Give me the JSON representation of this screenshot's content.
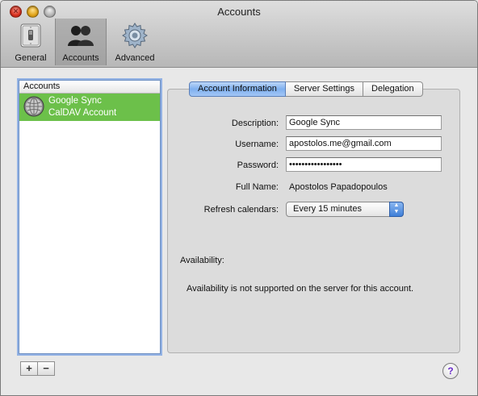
{
  "window": {
    "title": "Accounts"
  },
  "toolbar": {
    "items": [
      {
        "label": "General"
      },
      {
        "label": "Accounts"
      },
      {
        "label": "Advanced"
      }
    ]
  },
  "sidebar": {
    "header": "Accounts",
    "accounts": [
      {
        "name": "Google Sync",
        "type": "CalDAV Account",
        "selected_color": "#6cc04a"
      }
    ],
    "add_label": "+",
    "remove_label": "−"
  },
  "tabs": [
    {
      "label": "Account Information",
      "active": true
    },
    {
      "label": "Server Settings",
      "active": false
    },
    {
      "label": "Delegation",
      "active": false
    }
  ],
  "form": {
    "description_label": "Description:",
    "description_value": "Google Sync",
    "username_label": "Username:",
    "username_value": "apostolos.me@gmail.com",
    "password_label": "Password:",
    "password_value": "•••••••••••••••••",
    "fullname_label": "Full Name:",
    "fullname_value": "Apostolos Papadopoulos",
    "refresh_label": "Refresh calendars:",
    "refresh_value": "Every 15 minutes"
  },
  "availability": {
    "label": "Availability:",
    "message": "Availability is not supported on the server for this account."
  },
  "help_label": "?"
}
